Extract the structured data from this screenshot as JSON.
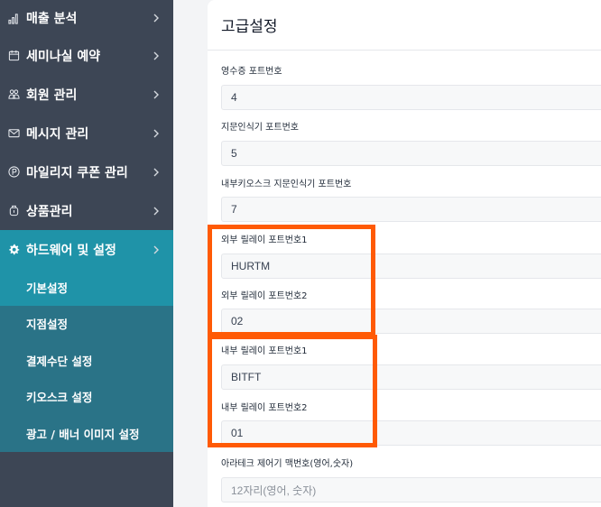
{
  "sidebar": {
    "items": [
      {
        "label": "매출 분석",
        "icon": "bar-chart-icon"
      },
      {
        "label": "세미나실 예약",
        "icon": "calendar-icon"
      },
      {
        "label": "회원 관리",
        "icon": "users-icon"
      },
      {
        "label": "메시지 관리",
        "icon": "mail-icon"
      },
      {
        "label": "마일리지 쿠폰 관리",
        "icon": "p-coin-icon"
      },
      {
        "label": "상품관리",
        "icon": "box-icon"
      },
      {
        "label": "하드웨어 및 설정",
        "icon": "gear-icon"
      }
    ],
    "subitems": [
      {
        "label": "기본설정"
      },
      {
        "label": "지점설정"
      },
      {
        "label": "결제수단 설정"
      },
      {
        "label": "키오스크 설정"
      },
      {
        "label": "광고 / 배너 이미지 설정"
      }
    ]
  },
  "main": {
    "title": "고급설정",
    "fields": [
      {
        "label": "영수증 포트번호",
        "value": "4"
      },
      {
        "label": "지문인식기 포트번호",
        "value": "5"
      },
      {
        "label": "내부키오스크 지문인식기 포트번호",
        "value": "7"
      },
      {
        "label": "외부 릴레이 포트번호1",
        "value": "HURTM"
      },
      {
        "label": "외부 릴레이 포트번호2",
        "value": "02"
      },
      {
        "label": "내부 릴레이 포트번호1",
        "value": "BITFT"
      },
      {
        "label": "내부 릴레이 포트번호2",
        "value": "01"
      },
      {
        "label": "아라테크 제어기 맥번호(영어,숫자)",
        "value": "",
        "placeholder": "12자리(영어, 숫자)"
      }
    ]
  },
  "colors": {
    "sidebar_bg": "#3d4655",
    "active_bg": "#1f93a8",
    "submenu_bg": "#2a7387",
    "highlight": "#ff5a05"
  }
}
